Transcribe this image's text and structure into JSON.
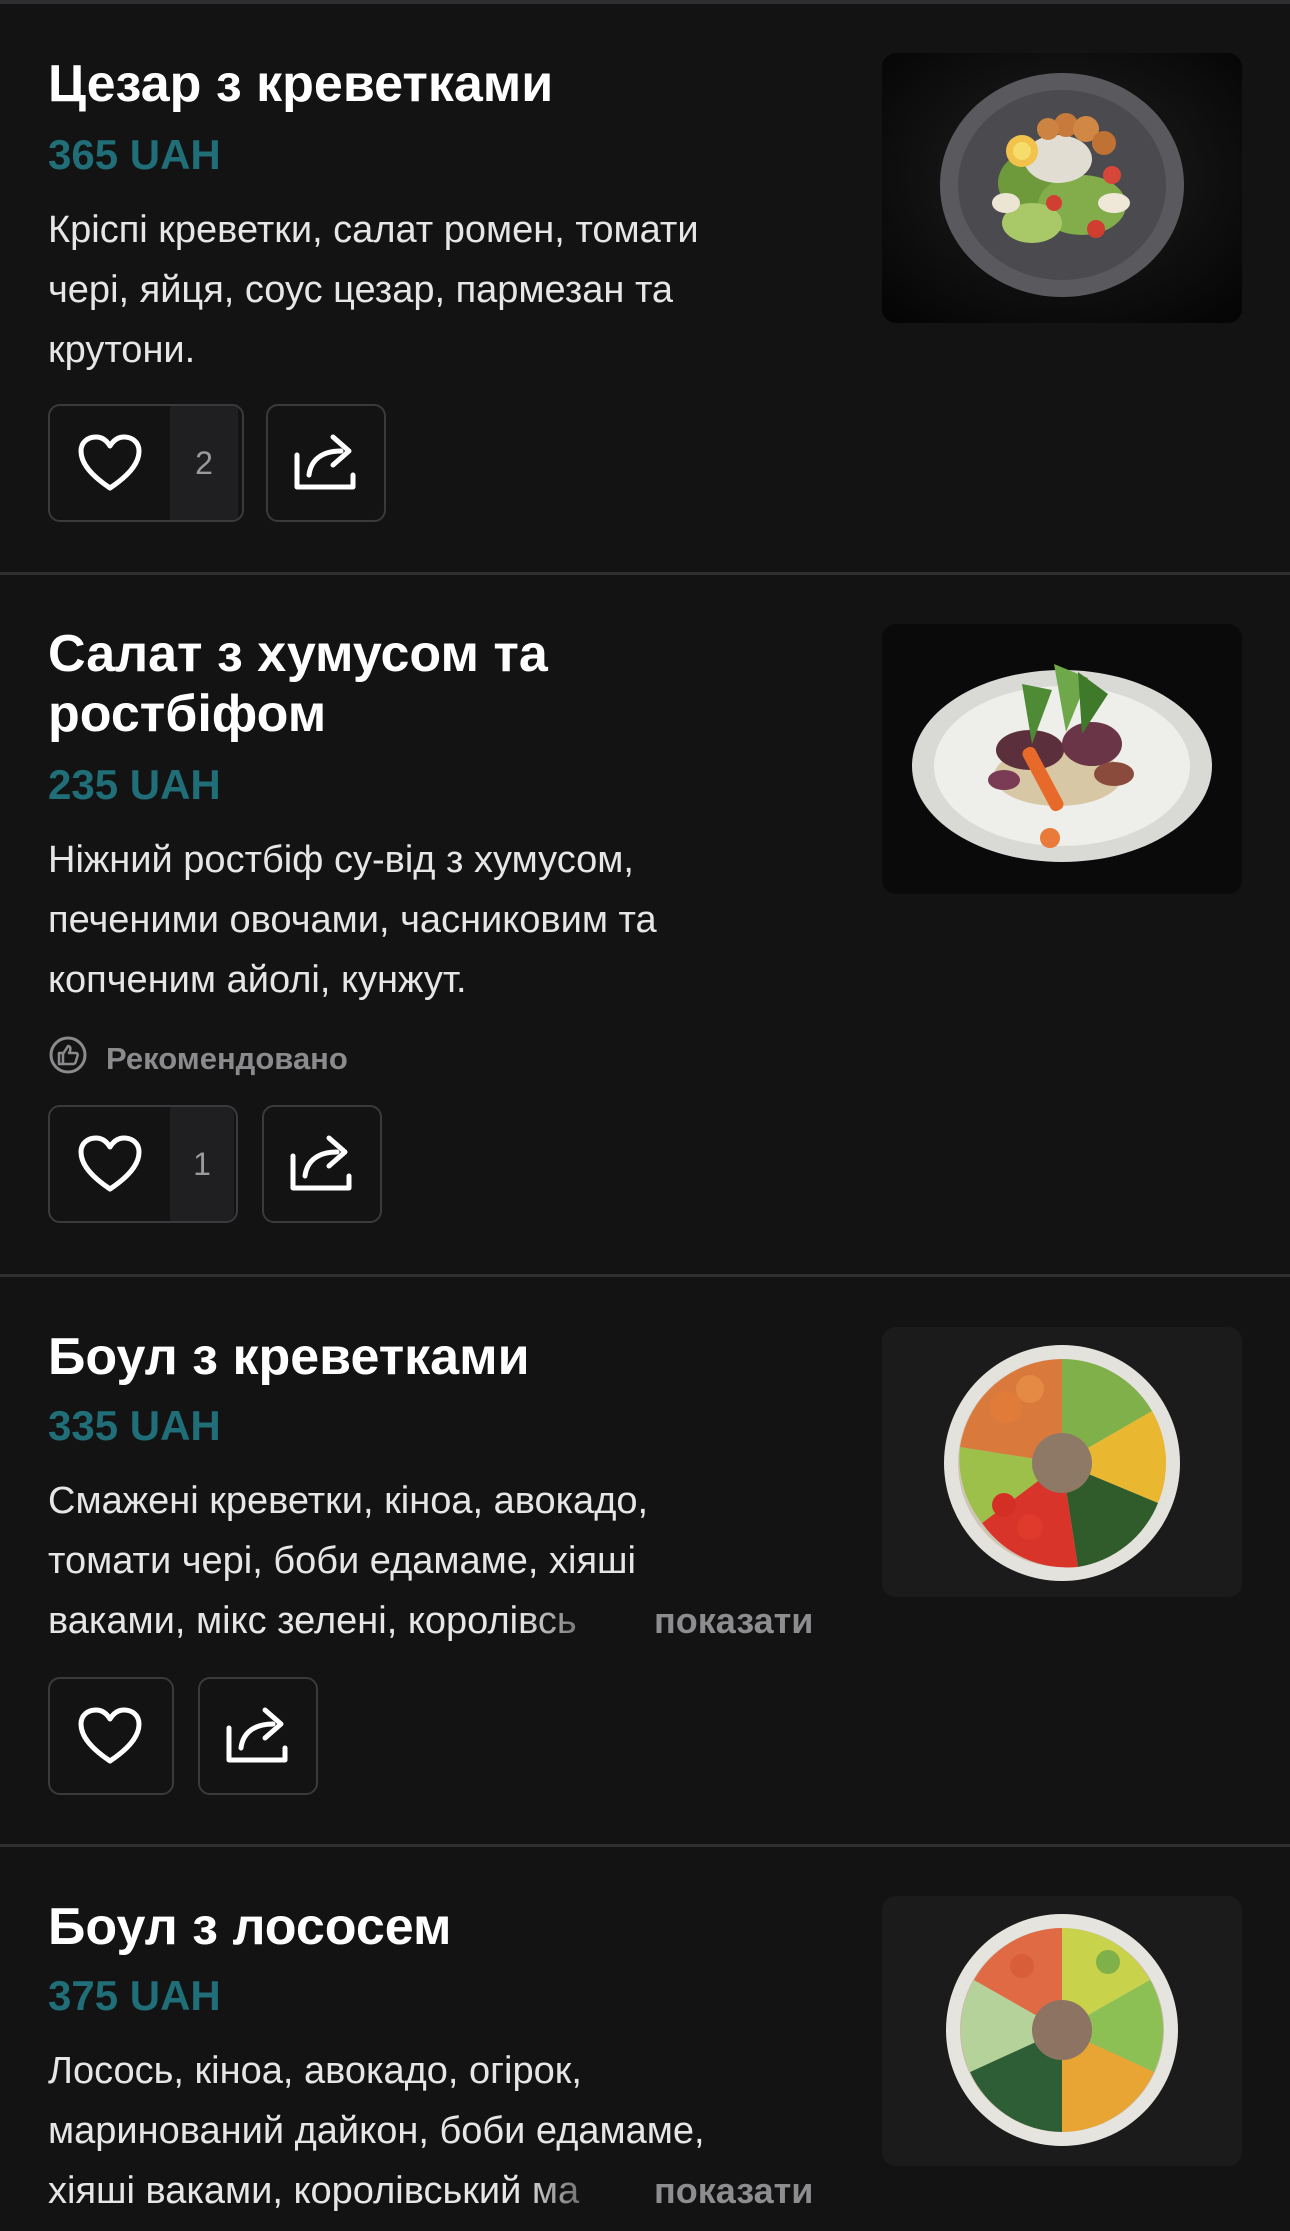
{
  "colors": {
    "background": "#131314",
    "price": "#1f6e78",
    "divider": "#2f2f31",
    "muted": "#8b8b8d"
  },
  "show_more_label": "показати",
  "items": [
    {
      "title": "Цезар з креветками",
      "price": "365 UAH",
      "description": "Кріспі креветки, салат ромен, томати\nчері, яйця, соус цезар, пармезан та\nкрутони.",
      "likes": "2",
      "like_icon": "heart-icon",
      "share_icon": "share-icon",
      "image": "caesar-salad-with-shrimp-photo"
    },
    {
      "title": "Салат з хумусом та ростбіфом",
      "price": "235 UAH",
      "description": "Ніжний ростбіф су-від з хумусом,\nпеченими овочами, часниковим та\nкопченим айолі, кунжут.",
      "badge": "Рекомендовано",
      "badge_icon": "thumbs-up-icon",
      "likes": "1",
      "image": "hummus-roastbeef-salad-photo"
    },
    {
      "title": "Боул з креветками",
      "price": "335 UAH",
      "description": "Смажені креветки, кіноа, авокадо,\nтомати чері, боби едамаме, хіяші\nваками, мікс зелені, королівсь",
      "image": "shrimp-bowl-photo"
    },
    {
      "title": "Боул з лососем",
      "price": "375 UAH",
      "description": "Лосось, кіноа, авокадо, огірок,\nмаринований дайкон, боби едамаме,\nхіяші ваками, королівський ма",
      "image": "salmon-bowl-photo"
    }
  ]
}
